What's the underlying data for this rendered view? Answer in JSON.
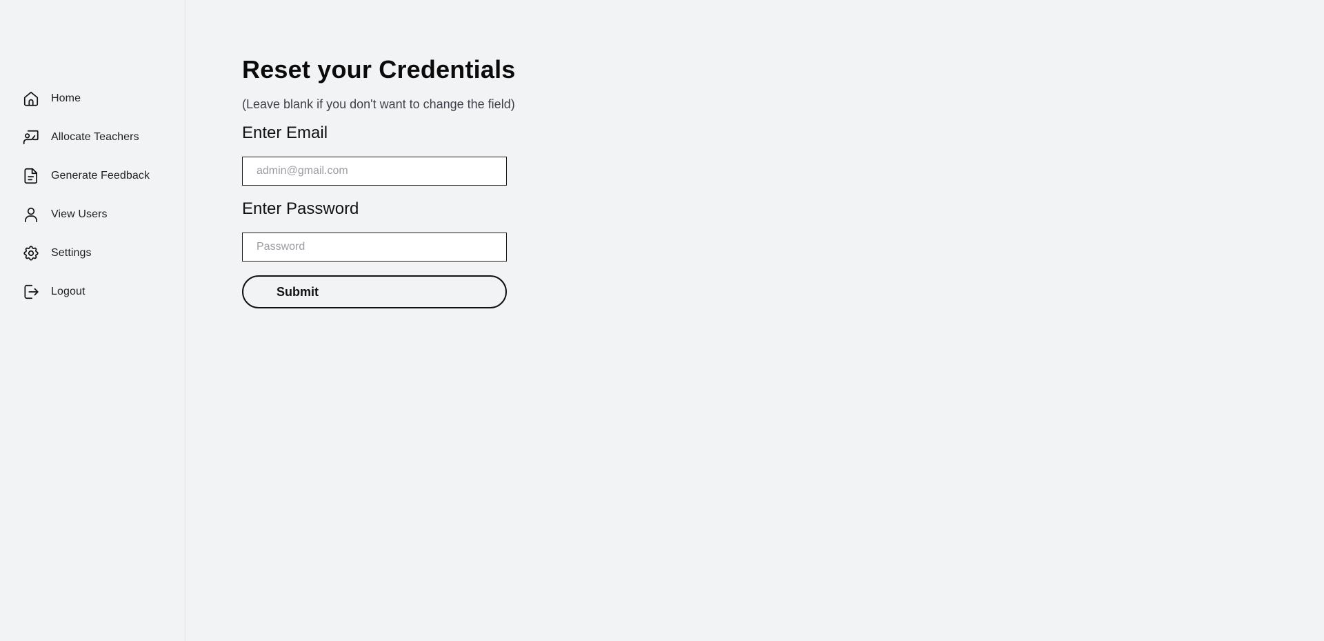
{
  "sidebar": {
    "items": [
      {
        "label": "Home",
        "icon": "home-icon"
      },
      {
        "label": "Allocate Teachers",
        "icon": "teacher-icon"
      },
      {
        "label": "Generate Feedback",
        "icon": "document-icon"
      },
      {
        "label": "View Users",
        "icon": "user-icon"
      },
      {
        "label": "Settings",
        "icon": "gear-icon"
      },
      {
        "label": "Logout",
        "icon": "logout-icon"
      }
    ]
  },
  "main": {
    "title": "Reset your Credentials",
    "subtitle": "(Leave blank if you don't want to change the field)",
    "email_label": "Enter Email",
    "email_placeholder": "admin@gmail.com",
    "email_value": "",
    "password_label": "Enter Password",
    "password_placeholder": "Password",
    "password_value": "",
    "submit_label": "Submit"
  },
  "colors": {
    "background": "#f2f3f5",
    "text": "#111111",
    "placeholder": "#9a9ca3",
    "input_background": "#ffffff"
  }
}
